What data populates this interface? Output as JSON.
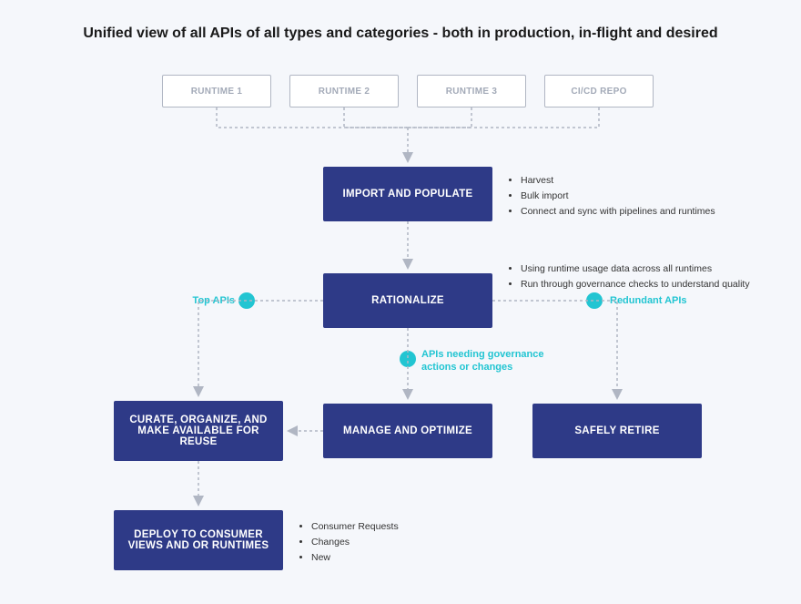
{
  "title": "Unified view of all APIs of all types and categories - both in production, in-flight and desired",
  "sources": {
    "runtime1": "RUNTIME 1",
    "runtime2": "RUNTIME 2",
    "runtime3": "RUNTIME 3",
    "cicd": "CI/CD REPO"
  },
  "steps": {
    "import": "IMPORT AND POPULATE",
    "rationalize": "RATIONALIZE",
    "curate": "CURATE, ORGANIZE, AND MAKE AVAILABLE FOR REUSE",
    "manage": "MANAGE AND OPTIMIZE",
    "retire": "SAFELY RETIRE",
    "deploy": "DEPLOY TO CONSUMER VIEWS AND OR RUNTIMES"
  },
  "annotations": {
    "top_apis": "Top APIs",
    "redundant": "Redundant APIs",
    "governance": "APIs needing governance actions or changes"
  },
  "bullets_import": {
    "b1": "Harvest",
    "b2": "Bulk import",
    "b3": "Connect and sync with pipelines and runtimes"
  },
  "bullets_rationalize": {
    "b1": "Using runtime usage data across all runtimes",
    "b2": "Run through governance checks to understand quality"
  },
  "bullets_deploy": {
    "b1": "Consumer Requests",
    "b2": "Changes",
    "b3": "New"
  }
}
